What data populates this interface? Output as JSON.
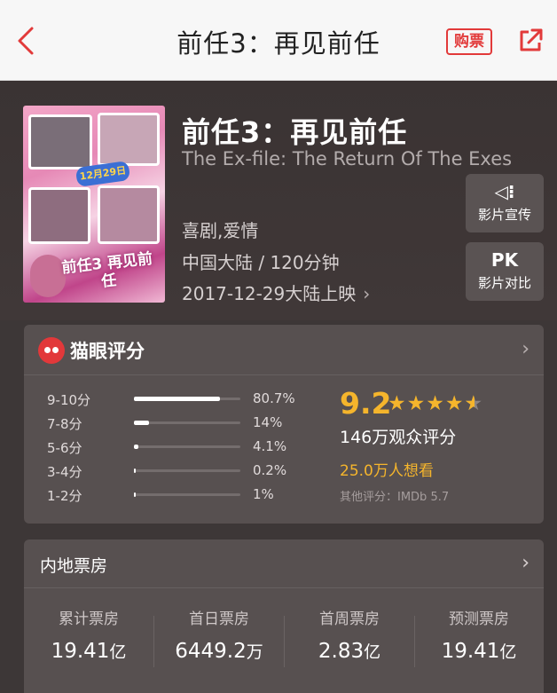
{
  "header": {
    "back_icon": "back-arrow-icon",
    "title": "前任3：再见前任",
    "buy_label": "购票",
    "share_icon": "share-icon",
    "accent_color": "#e23a3a"
  },
  "movie": {
    "title": "前任3：再见前任",
    "english_title": "The Ex-file: The Return Of The Exes",
    "genre": "喜剧,爱情",
    "region_duration": "中国大陆 / 120分钟",
    "release": "2017-12-29大陆上映",
    "release_chevron": "›",
    "poster": {
      "date_badge": "12月29日",
      "title_art": "前任3 再见前任"
    }
  },
  "side_buttons": {
    "promo": {
      "icon": "speaker-icon",
      "icon_glyph": "◁⁝",
      "label": "影片宣传"
    },
    "pk": {
      "icon": "pk-icon",
      "icon_glyph": "PK",
      "label": "影片对比"
    }
  },
  "rating": {
    "title": "猫眼评分",
    "chevron": "›",
    "distribution": [
      {
        "range": "9-10分",
        "percent": "80.7%",
        "fraction": 0.807
      },
      {
        "range": "7-8分",
        "percent": "14%",
        "fraction": 0.14
      },
      {
        "range": "5-6分",
        "percent": "4.1%",
        "fraction": 0.041
      },
      {
        "range": "3-4分",
        "percent": "0.2%",
        "fraction": 0.002
      },
      {
        "range": "1-2分",
        "percent": "1%",
        "fraction": 0.01
      }
    ],
    "score": "9.2",
    "stars": 4.5,
    "audience_count": "146万观众评分",
    "want_to_see": "25.0万人想看",
    "other_rating": "其他评分：IMDb 5.7",
    "score_color": "#f5b52c"
  },
  "box_office": {
    "title": "内地票房",
    "chevron": "›",
    "stats": [
      {
        "label": "累计票房",
        "value": "19.41",
        "unit": "亿"
      },
      {
        "label": "首日票房",
        "value": "6449.2",
        "unit": "万"
      },
      {
        "label": "首周票房",
        "value": "2.83",
        "unit": "亿"
      },
      {
        "label": "预测票房",
        "value": "19.41",
        "unit": "亿"
      }
    ]
  }
}
